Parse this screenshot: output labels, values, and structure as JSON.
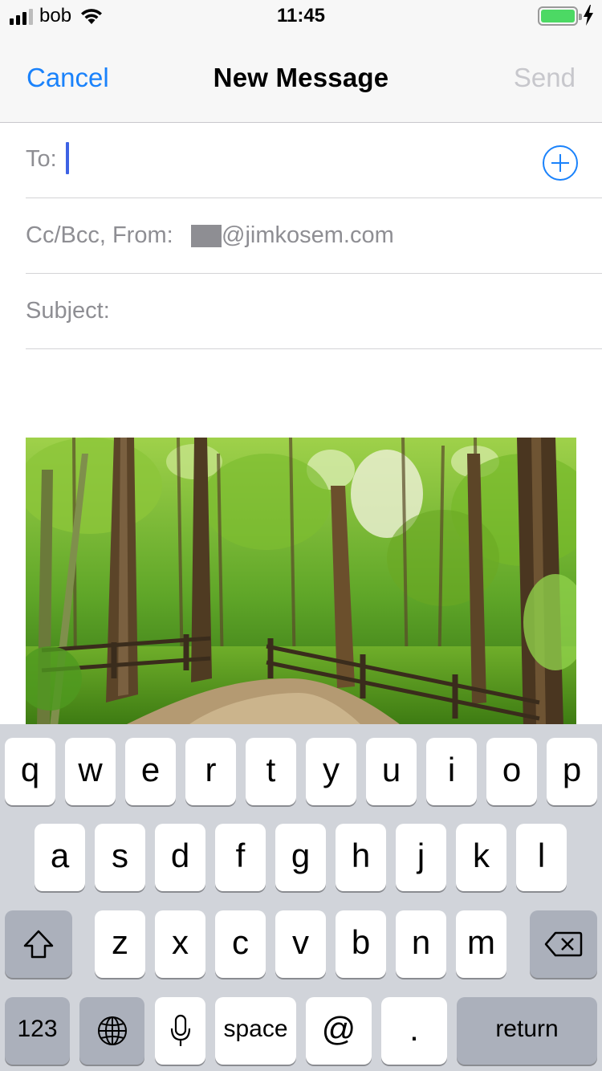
{
  "status_bar": {
    "carrier": "bob",
    "time": "11:45",
    "battery_level": 1.0,
    "charging": true,
    "icons": [
      "signal-icon",
      "wifi-icon",
      "battery-icon",
      "charging-bolt-icon"
    ]
  },
  "nav": {
    "cancel_label": "Cancel",
    "title": "New Message",
    "send_label": "Send",
    "accent_color": "#1a82fb",
    "send_disabled_color": "#c7c7cc"
  },
  "fields": {
    "to_label": "To:",
    "cc_from_label": "Cc/Bcc, From:",
    "from_email": "@jimkosem.com",
    "subject_label": "Subject:"
  },
  "body": {
    "image_icon": "forest-photo"
  },
  "keyboard": {
    "row1": [
      "q",
      "w",
      "e",
      "r",
      "t",
      "y",
      "u",
      "i",
      "o",
      "p"
    ],
    "row2": [
      "a",
      "s",
      "d",
      "f",
      "g",
      "h",
      "j",
      "k",
      "l"
    ],
    "row3": [
      "z",
      "x",
      "c",
      "v",
      "b",
      "n",
      "m"
    ],
    "numbers_label": "123",
    "space_label": "space",
    "at_label": "@",
    "period_label": ".",
    "return_label": "return",
    "icons": [
      "shift-icon",
      "delete-icon",
      "globe-icon",
      "microphone-icon"
    ]
  }
}
